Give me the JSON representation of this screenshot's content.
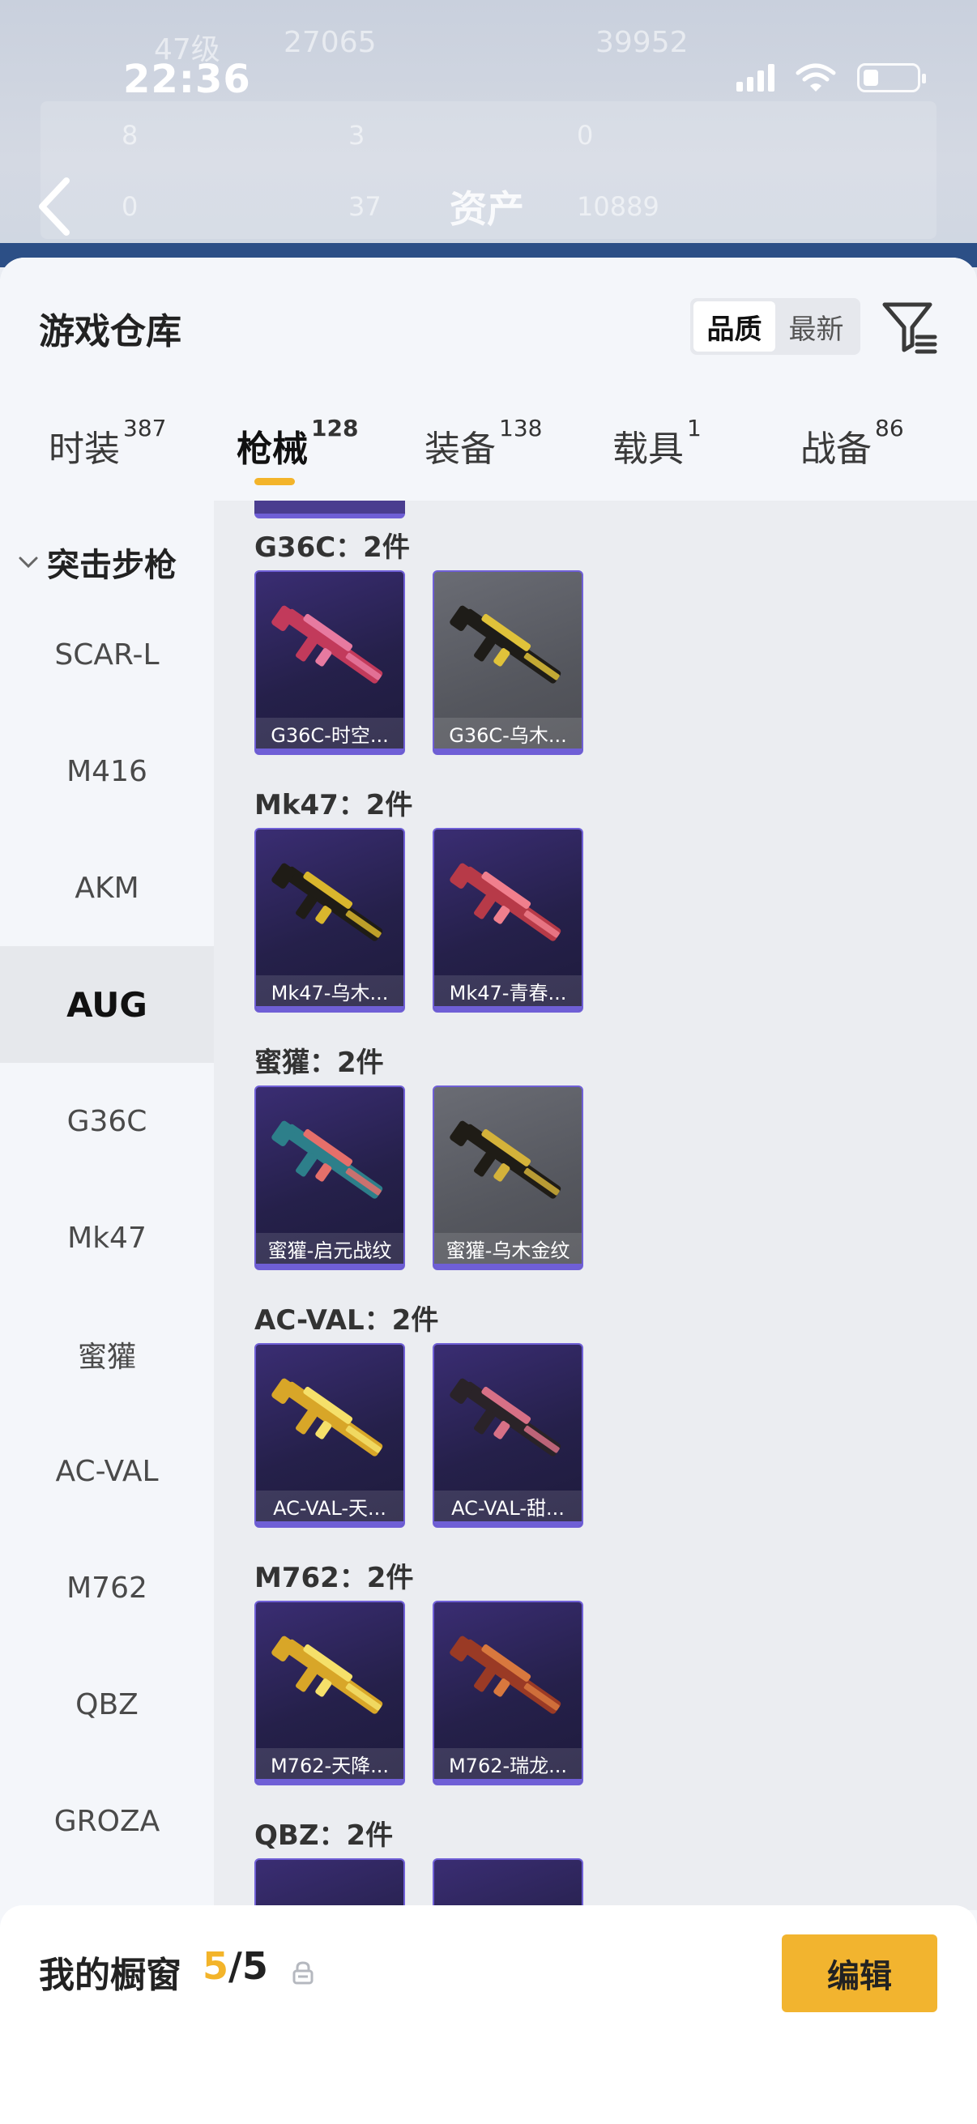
{
  "status_bar": {
    "time": "22:36"
  },
  "background_header": {
    "level": "47级",
    "stat_a": "27065",
    "stat_b": "39952",
    "row1": [
      "8",
      "3",
      "0"
    ],
    "row2": [
      "0",
      "37",
      "10889"
    ],
    "assets_title": "资产"
  },
  "sheet": {
    "title": "游戏仓库",
    "sort_options": [
      "品质",
      "最新"
    ],
    "sort_selected": "品质"
  },
  "tabs": [
    {
      "label": "时装",
      "count": "387"
    },
    {
      "label": "枪械",
      "count": "128",
      "active": true
    },
    {
      "label": "装备",
      "count": "138"
    },
    {
      "label": "载具",
      "count": "1"
    },
    {
      "label": "战备",
      "count": "86"
    }
  ],
  "sidebar": {
    "group": "突击步枪",
    "items": [
      "SCAR-L",
      "M416",
      "AKM",
      "AUG",
      "G36C",
      "Mk47",
      "蜜獾",
      "AC-VAL",
      "M762",
      "QBZ",
      "GROZA"
    ],
    "active": "AUG"
  },
  "categories": [
    {
      "label": "G36C：2件",
      "items": [
        {
          "name": "G36C-时空...",
          "style": "purple",
          "gun": "#c23a5b",
          "accent": "#e77aa0"
        },
        {
          "name": "G36C-乌木...",
          "style": "gray",
          "gun": "#1e1c18",
          "accent": "#e0c23a"
        }
      ]
    },
    {
      "label": "Mk47：2件",
      "items": [
        {
          "name": "Mk47-乌木...",
          "style": "purple",
          "gun": "#1f1c16",
          "accent": "#d9b62d"
        },
        {
          "name": "Mk47-青春...",
          "style": "purple",
          "gun": "#b73a48",
          "accent": "#f07f8d"
        }
      ]
    },
    {
      "label": "蜜獾：2件",
      "items": [
        {
          "name": "蜜獾-启元战纹",
          "style": "purple",
          "gun": "#2d7f8a",
          "accent": "#e56f6a"
        },
        {
          "name": "蜜獾-乌木金纹",
          "style": "gray",
          "gun": "#1f1c16",
          "accent": "#d4b23a"
        }
      ]
    },
    {
      "label": "AC-VAL：2件",
      "items": [
        {
          "name": "AC-VAL-天...",
          "style": "purple",
          "gun": "#d8a628",
          "accent": "#f5e06a"
        },
        {
          "name": "AC-VAL-甜...",
          "style": "purple",
          "gun": "#2a2328",
          "accent": "#d77086"
        }
      ]
    },
    {
      "label": "M762：2件",
      "items": [
        {
          "name": "M762-天降...",
          "style": "purple",
          "gun": "#d8a628",
          "accent": "#f5e06a"
        },
        {
          "name": "M762-瑞龙...",
          "style": "purple",
          "gun": "#9a3a25",
          "accent": "#d8783e"
        }
      ]
    },
    {
      "label": "QBZ：2件",
      "items": []
    }
  ],
  "showcase": {
    "title": "我的橱窗",
    "current": "5",
    "total": "/5",
    "edit_label": "编辑"
  },
  "colors": {
    "accent": "#f3b42a",
    "card_border": "#6f5fd6"
  }
}
